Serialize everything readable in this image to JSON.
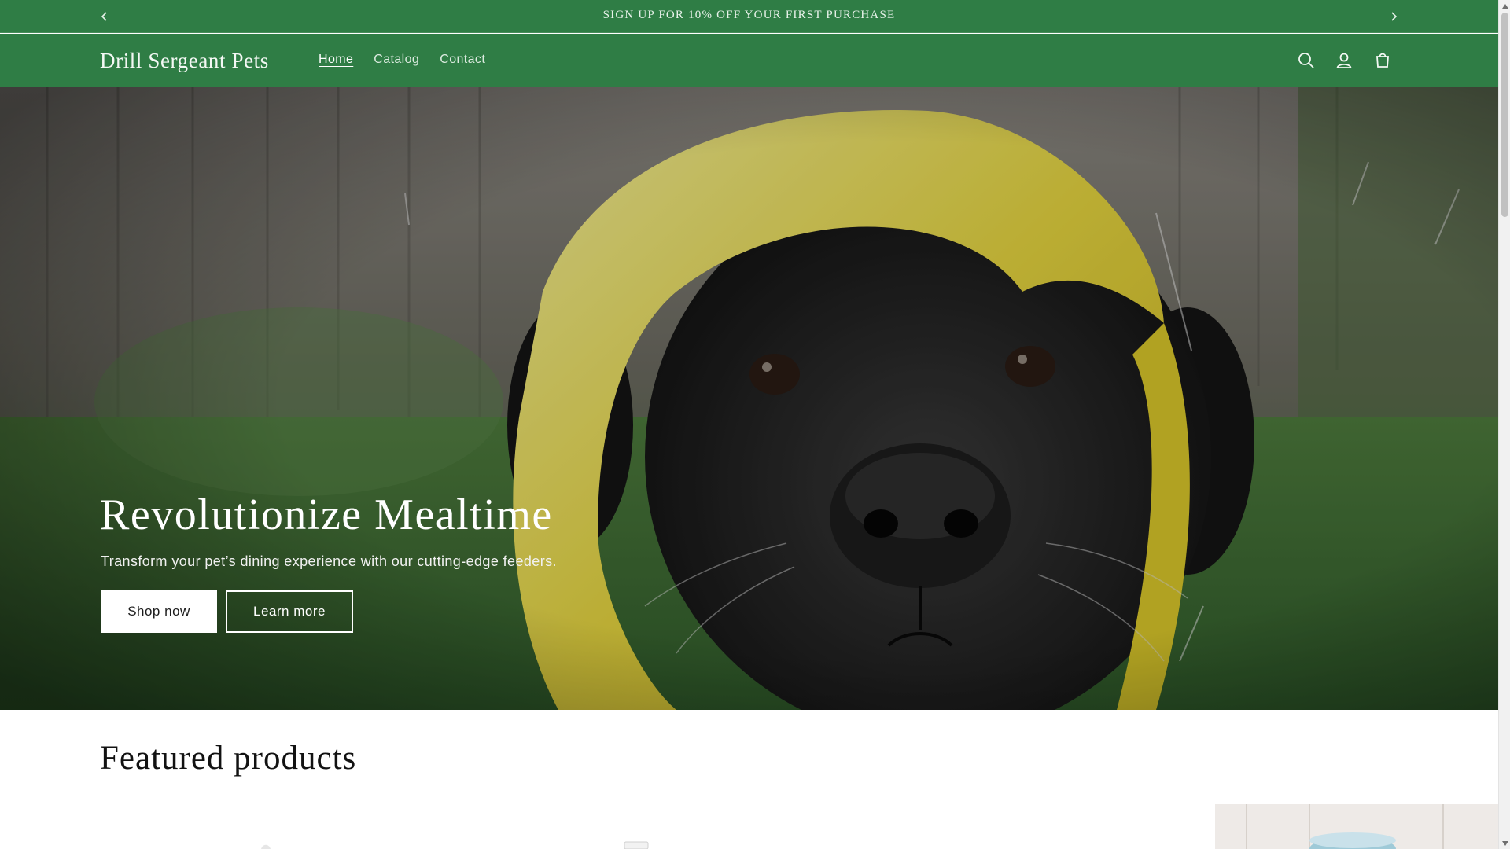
{
  "announcement": {
    "text": "SIGN UP FOR 10% OFF YOUR FIRST PURCHASE",
    "prev_icon": "chevron-left-icon",
    "next_icon": "chevron-right-icon"
  },
  "header": {
    "logo": "Drill Sergeant Pets",
    "nav": [
      {
        "label": "Home",
        "active": true
      },
      {
        "label": "Catalog",
        "active": false
      },
      {
        "label": "Contact",
        "active": false
      }
    ],
    "icons": [
      "search-icon",
      "account-icon",
      "cart-icon"
    ]
  },
  "hero": {
    "title": "Revolutionize Mealtime",
    "subtitle": "Transform your pet’s dining experience with our cutting-edge feeders.",
    "primary_button": "Shop now",
    "secondary_button": "Learn more"
  },
  "featured": {
    "title": "Featured products"
  },
  "colors": {
    "brand_green": "#2f7d45",
    "hero_button_bg": "#ffffff",
    "text_dark": "#121212"
  }
}
